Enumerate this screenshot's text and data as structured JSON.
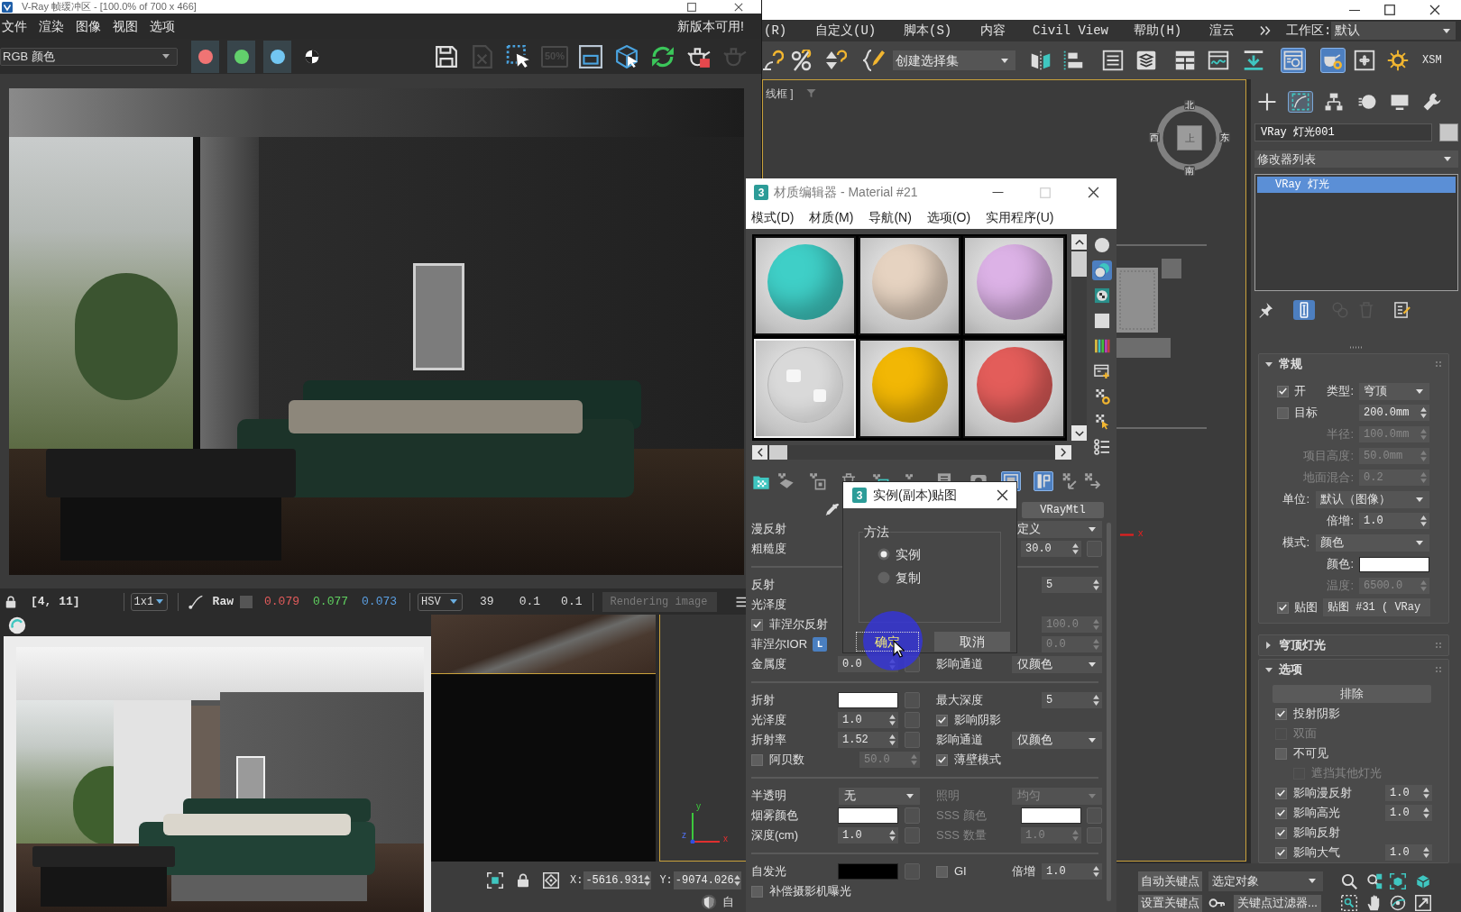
{
  "vfb": {
    "title": "V-Ray 帧缓冲区 - [100.0% of 700 x 466]",
    "menu": [
      "文件",
      "渲染",
      "图像",
      "视图",
      "选项"
    ],
    "notice": "新版本可用!",
    "channel": "RGB 颜色",
    "channel_toggles": [
      {
        "color": "#f07474"
      },
      {
        "color": "#62d06c"
      },
      {
        "color": "#72c6f2"
      }
    ],
    "tools": [
      {
        "disabled": false
      },
      {
        "disabled": true
      },
      {
        "disabled": false
      },
      {
        "disabled": true,
        "label": "50%"
      },
      {
        "disabled": false
      },
      {
        "disabled": false
      },
      {
        "disabled": false
      },
      {
        "disabled": false
      },
      {
        "disabled": true
      }
    ],
    "status": {
      "coords": "[4, 11]",
      "sampling": "1x1",
      "mode": "Raw",
      "swatch": {
        "color": "#555555"
      },
      "values": [
        {
          "text": "0.079",
          "color": "#e25b5b"
        },
        {
          "text": "0.077",
          "color": "#5fcf5f"
        },
        {
          "text": "0.073",
          "color": "#5b9fe2"
        }
      ],
      "color_space": "HSV",
      "hsv": [
        "39",
        "0.1",
        "0.1"
      ],
      "progress": "Rendering image"
    }
  },
  "max": {
    "menu": [
      "(R)",
      "自定义(U)",
      "脚本(S)",
      "内容",
      "Civil View",
      "帮助(H)",
      "渲云"
    ],
    "workspace_label": "工作区:",
    "workspace": "默认",
    "selection_set": "创建选择集",
    "toolbar": [
      {
        "selected": false
      },
      {
        "selected": false
      },
      {
        "selected": false
      },
      {
        "selected": false
      },
      {
        "selected": false
      },
      {
        "selected": false
      },
      {
        "selected": false
      },
      {
        "selected": true
      },
      {
        "selected": true
      },
      {
        "selected": false
      },
      {
        "selected": false
      }
    ],
    "toolbar_text": "XSM",
    "viewport_label": "线框 ]",
    "compass": {
      "north": "北",
      "west": "西",
      "east": "东",
      "south": "南",
      "top": "上"
    },
    "gizmo_axis": "x",
    "tripod": [
      "y",
      "z",
      "x"
    ],
    "coords": [
      {
        "axis": "X:",
        "value": "-5616.931"
      },
      {
        "axis": "Y:",
        "value": "-9074.026"
      }
    ],
    "footer_fragment": "自"
  },
  "command_panel": {
    "tabs": [
      {
        "selected": false
      },
      {
        "selected": true
      },
      {
        "selected": false
      },
      {
        "selected": false
      },
      {
        "selected": false
      },
      {
        "selected": false
      }
    ],
    "object_name": "VRay 灯光001",
    "object_swatch": {
      "color": "#c8c8c8"
    },
    "modifier_list": "修改器列表",
    "stack": [
      {
        "label": "VRay 灯光",
        "selected": true
      }
    ],
    "stack_tools": [
      {
        "selected": false,
        "disabled": false
      },
      {
        "selected": true,
        "disabled": false
      },
      {
        "selected": false,
        "disabled": true
      },
      {
        "selected": false,
        "disabled": true
      },
      {
        "selected": false,
        "disabled": false
      }
    ],
    "rollouts": [
      {
        "title": "常规",
        "expanded": true,
        "rows": [
          {
            "kind": "check_dropdown",
            "checked": true,
            "label": "开",
            "field_label": "类型:",
            "value": "穹顶"
          },
          {
            "kind": "check_spinner",
            "checked": false,
            "label": "目标",
            "value": "200.0mm"
          },
          {
            "kind": "spinner",
            "label": "半径:",
            "value": "100.0mm",
            "disabled": true
          },
          {
            "kind": "spinner",
            "label": "项目高度:",
            "value": "50.0mm",
            "disabled": true
          },
          {
            "kind": "spinner",
            "label": "地面混合:",
            "value": "0.2",
            "disabled": true
          },
          {
            "kind": "dropdown",
            "label": "单位:",
            "value": "默认（图像）"
          },
          {
            "kind": "spinner",
            "label": "倍增:",
            "value": "1.0",
            "disabled": false
          },
          {
            "kind": "dropdown",
            "label": "模式:",
            "value": "颜色"
          },
          {
            "kind": "swatch",
            "label": "颜色:",
            "color": "#ffffff"
          },
          {
            "kind": "spinner",
            "label": "温度:",
            "value": "6500.0",
            "disabled": true
          },
          {
            "kind": "check_button",
            "checked": true,
            "label": "贴图",
            "value": "贴图 #31 ( VRay"
          }
        ]
      },
      {
        "title": "穹顶灯光",
        "expanded": false
      },
      {
        "title": "选项",
        "expanded": true,
        "rows": [
          {
            "kind": "button",
            "value": "排除"
          },
          {
            "kind": "check",
            "checked": true,
            "label": "投射阴影",
            "disabled": false
          },
          {
            "kind": "check",
            "checked": false,
            "label": "双面",
            "disabled": true
          },
          {
            "kind": "check",
            "checked": false,
            "label": "不可见",
            "disabled": false,
            "children": [
              {
                "kind": "check",
                "checked": false,
                "label": "遮挡其他灯光",
                "disabled": true
              }
            ]
          },
          {
            "kind": "check_value",
            "checked": true,
            "label": "影响漫反射",
            "value": "1.0"
          },
          {
            "kind": "check_value",
            "checked": true,
            "label": "影响高光",
            "value": "1.0"
          },
          {
            "kind": "check",
            "checked": true,
            "label": "影响反射",
            "disabled": false
          },
          {
            "kind": "check_value",
            "checked": true,
            "label": "影响大气",
            "value": "1.0"
          }
        ]
      }
    ]
  },
  "anim": {
    "auto_key": "自动关键点",
    "selection": "选定对象",
    "set_key": "设置关键点",
    "key_filters": "关键点过滤器..."
  },
  "material_editor": {
    "logo": "3",
    "title": "材质编辑器 - Material #21",
    "menu": [
      "模式(D)",
      "材质(M)",
      "导航(N)",
      "选项(O)",
      "实用程序(U)"
    ],
    "slots": [
      {
        "kind": "solid",
        "color": "#3fcfc7",
        "selected": false
      },
      {
        "kind": "solid",
        "color": "#e6d3c1",
        "selected": false
      },
      {
        "kind": "solid",
        "color": "#dcb2e6",
        "selected": false
      },
      {
        "kind": "glass",
        "color": "#d9d9d9",
        "selected": true
      },
      {
        "kind": "solid",
        "color": "#f2b705",
        "selected": false
      },
      {
        "kind": "solid",
        "color": "#e35d5a",
        "selected": false
      }
    ],
    "side_tools": [
      {
        "selected": false
      },
      {
        "selected": true
      },
      {
        "selected": false
      },
      {
        "selected": false
      },
      {
        "selected": false
      },
      {
        "selected": false
      },
      {
        "selected": false
      },
      {
        "selected": false
      },
      {
        "selected": false
      }
    ],
    "tools": [
      {
        "selected": false
      },
      {
        "selected": false
      },
      {
        "selected": false
      },
      {
        "selected": false
      },
      {
        "selected": false
      },
      {
        "selected": false
      },
      {
        "selected": false
      },
      {
        "selected": false
      },
      {
        "selected": true
      },
      {
        "selected": true
      },
      {
        "selected": false
      },
      {
        "selected": false
      }
    ],
    "material_type": "VRayMtl",
    "parameters": [
      {
        "kind": "row",
        "left": {
          "label": "漫反射"
        },
        "right": {
          "field": {
            "kind": "dropdown",
            "value": "定义"
          }
        }
      },
      {
        "kind": "row",
        "left": {
          "label": "粗糙度"
        },
        "right": {
          "field": {
            "kind": "spinner",
            "value": "30.0"
          },
          "map": true
        }
      },
      {
        "kind": "divider"
      },
      {
        "kind": "row",
        "left": {
          "label": "反射"
        },
        "right": {
          "field": {
            "kind": "spinner",
            "value": "5"
          }
        }
      },
      {
        "kind": "row",
        "left": {
          "label": "光泽度"
        }
      },
      {
        "kind": "row",
        "left": {
          "label": "菲涅尔反射",
          "checked": true
        },
        "right": {
          "field": {
            "kind": "spinner",
            "value": "100.0",
            "disabled": true
          }
        }
      },
      {
        "kind": "row",
        "left": {
          "label": "菲涅尔IOR",
          "badge": "L"
        },
        "right": {
          "field": {
            "kind": "spinner",
            "value": "0.0",
            "disabled": true
          }
        }
      },
      {
        "kind": "row",
        "left": {
          "label": "金属度",
          "field": {
            "kind": "spinner",
            "value": "0.0"
          },
          "map": true
        },
        "right": {
          "label": "影响通道",
          "field": {
            "kind": "dropdown",
            "value": "仅颜色"
          }
        }
      },
      {
        "kind": "divider"
      },
      {
        "kind": "row",
        "left": {
          "label": "折射",
          "field": {
            "kind": "swatch",
            "color": "#ffffff"
          },
          "map": true
        },
        "right": {
          "label": "最大深度",
          "field": {
            "kind": "spinner",
            "value": "5"
          }
        }
      },
      {
        "kind": "row",
        "left": {
          "label": "光泽度",
          "field": {
            "kind": "spinner",
            "value": "1.0"
          },
          "map": true
        },
        "right": {
          "label": "影响阴影",
          "checked": true
        }
      },
      {
        "kind": "row",
        "left": {
          "label": "折射率",
          "field": {
            "kind": "spinner",
            "value": "1.52"
          },
          "map": true
        },
        "right": {
          "label": "影响通道",
          "field": {
            "kind": "dropdown",
            "value": "仅颜色"
          }
        }
      },
      {
        "kind": "row",
        "left": {
          "label": "阿贝数",
          "checked": false,
          "field": {
            "kind": "spinner",
            "value": "50.0",
            "disabled": true
          }
        },
        "right": {
          "label": "薄壁模式",
          "checked": true
        }
      },
      {
        "kind": "divider"
      },
      {
        "kind": "row",
        "left": {
          "label": "半透明",
          "field": {
            "kind": "dropdown",
            "value": "无"
          }
        },
        "right": {
          "label": "照明",
          "disabled": true,
          "field": {
            "kind": "dropdown",
            "value": "均匀",
            "disabled": true
          }
        }
      },
      {
        "kind": "row",
        "left": {
          "label": "烟雾颜色",
          "field": {
            "kind": "swatch",
            "color": "#ffffff"
          },
          "map": true
        },
        "right": {
          "label": "SSS 颜色",
          "disabled": true,
          "field": {
            "kind": "swatch",
            "color": "#ffffff"
          },
          "map": true
        }
      },
      {
        "kind": "row",
        "left": {
          "label": "深度(cm)",
          "field": {
            "kind": "spinner",
            "value": "1.0"
          },
          "map": true
        },
        "right": {
          "label": "SSS 数量",
          "disabled": true,
          "field": {
            "kind": "spinner",
            "value": "1.0",
            "disabled": true
          },
          "map": true
        }
      },
      {
        "kind": "divider"
      },
      {
        "kind": "row",
        "left": {
          "label": "自发光",
          "field": {
            "kind": "swatch",
            "color": "#000000"
          },
          "map": true
        },
        "right": {
          "label": "GI",
          "checked": false,
          "extra_label": "倍增",
          "field": {
            "kind": "spinner",
            "value": "1.0"
          }
        }
      },
      {
        "kind": "row",
        "left": {
          "label": "补偿摄影机曝光",
          "checked": false
        }
      }
    ]
  },
  "dialog": {
    "logo": "3",
    "title": "实例(副本)贴图",
    "group": "方法",
    "options": [
      {
        "label": "实例",
        "selected": true
      },
      {
        "label": "复制",
        "selected": false
      }
    ],
    "buttons": [
      {
        "label": "确定",
        "focused": true
      },
      {
        "label": "取消",
        "focused": false
      }
    ]
  }
}
